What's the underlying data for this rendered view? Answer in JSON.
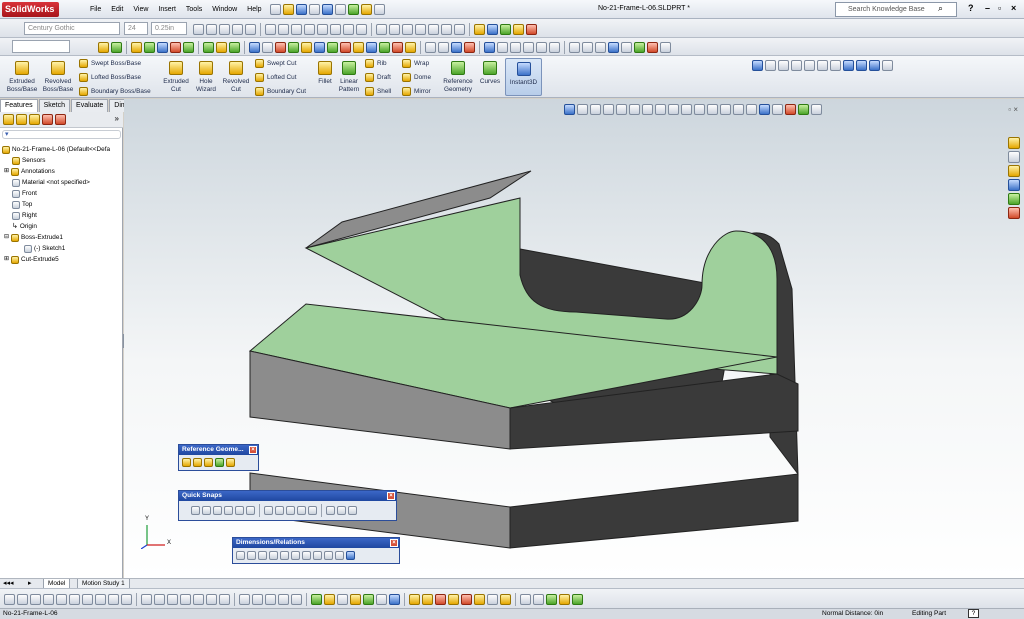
{
  "app": {
    "logo": "SolidWorks",
    "window_title": "No-21-Frame-L-06.SLDPRT *"
  },
  "menu": [
    "File",
    "Edit",
    "View",
    "Insert",
    "Tools",
    "Window",
    "Help"
  ],
  "search": {
    "placeholder": "Search Knowledge Base"
  },
  "format_bar": {
    "font": "Century Gothic",
    "size": "24",
    "height": "0.25in"
  },
  "command_manager": {
    "extruded_boss": "Extruded Boss/Base",
    "revolved_boss": "Revolved Boss/Base",
    "swept_boss": "Swept Boss/Base",
    "lofted_boss": "Lofted Boss/Base",
    "boundary_boss": "Boundary Boss/Base",
    "extruded_cut": "Extruded Cut",
    "hole_wizard": "Hole Wizard",
    "revolved_cut": "Revolved Cut",
    "swept_cut": "Swept Cut",
    "lofted_cut": "Lofted Cut",
    "boundary_cut": "Boundary Cut",
    "fillet": "Fillet",
    "linear_pattern": "Linear Pattern",
    "rib": "Rib",
    "draft": "Draft",
    "shell": "Shell",
    "wrap": "Wrap",
    "dome": "Dome",
    "mirror": "Mirror",
    "reference_geometry": "Reference Geometry",
    "curves": "Curves",
    "instant3d": "Instant3D"
  },
  "tabs": [
    "Features",
    "Sketch",
    "Evaluate",
    "DimXpert"
  ],
  "tree": {
    "root": "No-21-Frame-L-06  (Default<<Defa",
    "items": [
      "Sensors",
      "Annotations",
      "Material <not specified>",
      "Front",
      "Top",
      "Right",
      "Origin",
      "Boss-Extrude1",
      "(-) Sketch1",
      "Cut-Extrude5"
    ]
  },
  "toolbars": {
    "reference_geometry": "Reference Geome...",
    "quick_snaps": "Quick Snaps",
    "dimensions_relations": "Dimensions/Relations"
  },
  "triad": {
    "x": "X",
    "y": "Y"
  },
  "model_tabs": [
    "Model",
    "Motion Study 1"
  ],
  "status": {
    "left": "No-21-Frame-L-06",
    "distance": "Normal Distance: 0in",
    "mode": "Editing Part",
    "help": "?"
  },
  "colors": {
    "face_green": "#9fd09c",
    "face_gray": "#8c8c8c",
    "face_dark": "#3a3a3a",
    "brand_red": "#c1272d"
  }
}
